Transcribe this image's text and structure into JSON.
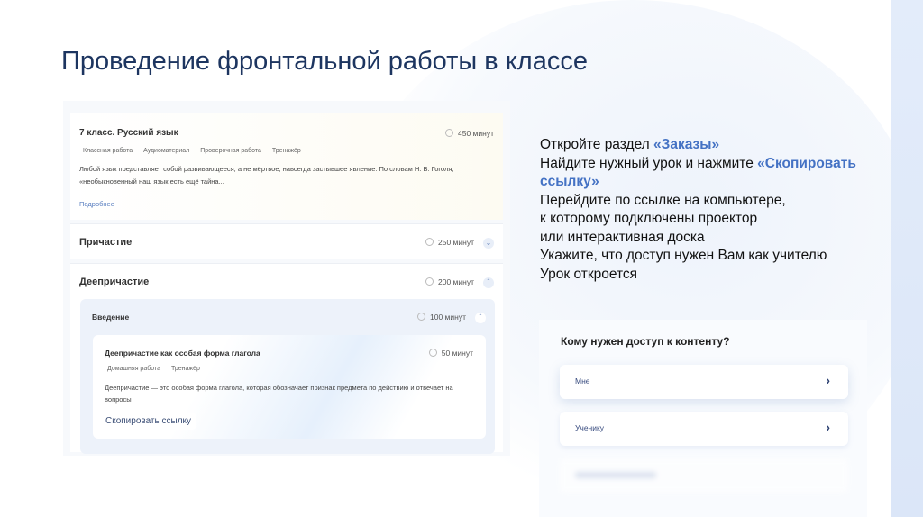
{
  "slide": {
    "title": "Проведение фронтальной работы в классе"
  },
  "instructions": {
    "line1_prefix": "Откройте раздел ",
    "line1_hl": "«Заказы»",
    "line2_prefix": "Найдите нужный урок и нажмите ",
    "line2_hl": "«Скопировать ссылку»",
    "line3": "Перейдите по ссылке на компьютере,",
    "line4": "к которому подключены проектор",
    "line5": "или интерактивная доска",
    "line6": "Укажите, что доступ нужен Вам как учителю",
    "line7": "Урок откроется"
  },
  "course": {
    "title": "7 класс. Русский язык",
    "duration": "450 минут",
    "tags": [
      "Классная работа",
      "Аудиоматериал",
      "Проверочная работа",
      "Тренажёр"
    ],
    "description": "Любой язык представляет собой развивающееся, а не мёртвое, навсегда застывшее явление. По словам Н. В. Гоголя, «необыкновенный наш язык есть ещё тайна...",
    "more_link": "Подробнее",
    "sections": [
      {
        "title": "Причастие",
        "duration": "250 минут"
      },
      {
        "title": "Деепричастие",
        "duration": "200 минут"
      }
    ],
    "subsection": {
      "title": "Введение",
      "duration": "100 минут"
    },
    "lesson": {
      "title": "Деепричастие как особая форма глагола",
      "duration": "50 минут",
      "tags": [
        "Домашняя работа",
        "Тренажёр"
      ],
      "description": "Деепричастие — это особая форма глагола, которая обозначает признак предмета по действию и отвечает на вопросы",
      "copy_button": "Скопировать ссылку"
    }
  },
  "access": {
    "question": "Кому нужен доступ к контенту?",
    "options": [
      "Мне",
      "Ученику"
    ]
  },
  "colors": {
    "title": "#1d3560",
    "highlight": "#4472c4"
  }
}
